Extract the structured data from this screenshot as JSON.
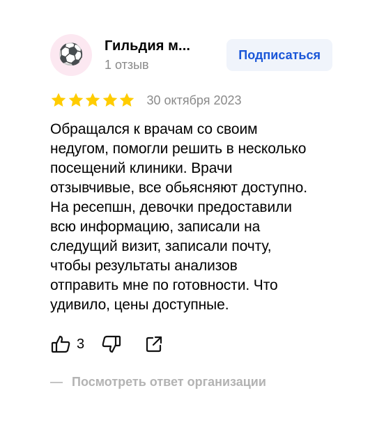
{
  "author": {
    "name": "Гильдия м...",
    "reviews_count": "1 отзыв",
    "avatar_emoji": "⚽"
  },
  "subscribe_label": "Подписаться",
  "rating": {
    "stars": 5,
    "max": 5,
    "color": "#ffcc00"
  },
  "review": {
    "date": "30 октября 2023",
    "text": "Обращался к врачам со своим недугом, помогли решить в несколько посещений клиники. Врачи отзывчивые, все обьясняют доступно. На ресепшн, девочки предоставили всю информацию, записали на следущий визит, записали почту, чтобы результаты анализов отправить мне по готовности. Что удивило, цены доступные."
  },
  "actions": {
    "like_count": "3",
    "like_icon": "thumbs-up-icon",
    "dislike_icon": "thumbs-down-icon",
    "share_icon": "share-icon"
  },
  "org_reply_label": "Посмотреть ответ организации",
  "colors": {
    "accent": "#1a56d8",
    "subscribe_bg": "#f0f4fb",
    "muted": "#8a8a8a"
  }
}
